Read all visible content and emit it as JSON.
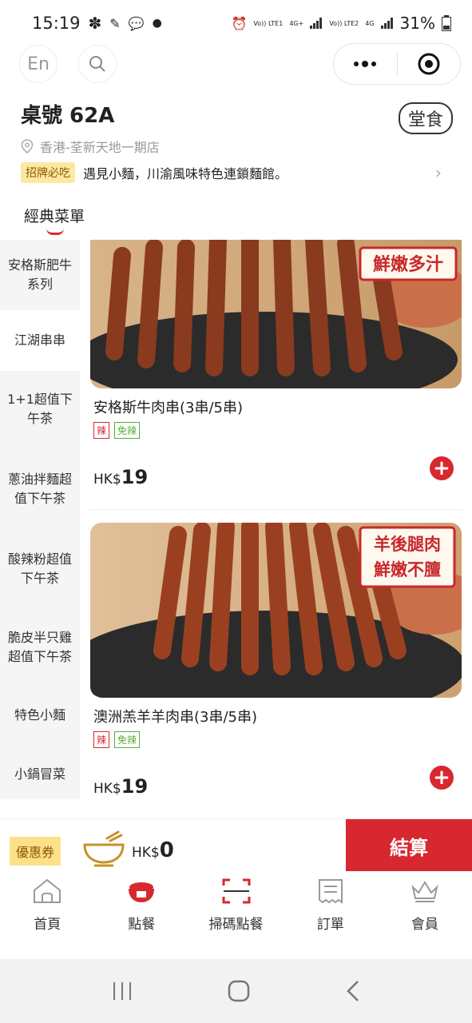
{
  "status": {
    "time": "15:19",
    "sim1": "Vo)) LTE1",
    "sim1_net": "4G+",
    "sim2": "Vo)) LTE2",
    "sim2_net": "4G",
    "battery": "31%"
  },
  "top": {
    "lang_label": "En"
  },
  "store": {
    "table_no": "桌號 62A",
    "dine_mode": "堂食",
    "location": "香港-荃新天地一期店",
    "notice_tag": "招牌必吃",
    "notice_text": "遇見小麵，川渝風味特色連鎖麵館。"
  },
  "menu_tab": "經典菜單",
  "sidebar": {
    "items": [
      {
        "label": "安格斯肥牛系列"
      },
      {
        "label": "江湖串串"
      },
      {
        "label": "1+1超值下午茶"
      },
      {
        "label": "蔥油拌麵超值下午茶"
      },
      {
        "label": "酸辣粉超值下午茶"
      },
      {
        "label": "脆皮半只雞超值下午茶"
      },
      {
        "label": "特色小麵"
      },
      {
        "label": "小鍋冒菜"
      }
    ]
  },
  "products": [
    {
      "image_caption": "鮮嫩多汁",
      "name": "安格斯牛肉串(3串/5串)",
      "tag_spicy": "辣",
      "tag_nospicy": "免辣",
      "currency": "HK$",
      "price": "19"
    },
    {
      "image_caption_1": "羊後腿肉",
      "image_caption_2": "鮮嫩不膻",
      "name": "澳洲羔羊羊肉串(3串/5串)",
      "tag_spicy": "辣",
      "tag_nospicy": "免辣",
      "currency": "HK$",
      "price": "19"
    }
  ],
  "cart": {
    "coupon_label": "優惠券",
    "currency": "HK$",
    "total": "0",
    "checkout_label": "結算"
  },
  "bottom_nav": [
    {
      "label": "首頁",
      "icon": "home-icon"
    },
    {
      "label": "點餐",
      "icon": "bowl-icon"
    },
    {
      "label": "掃碼點餐",
      "icon": "scan-icon"
    },
    {
      "label": "訂單",
      "icon": "receipt-icon"
    },
    {
      "label": "會員",
      "icon": "crown-icon"
    }
  ],
  "colors": {
    "accent": "#d7282f",
    "coupon_bg": "#fde08a",
    "sidebar_bg": "#f5f5f5"
  }
}
